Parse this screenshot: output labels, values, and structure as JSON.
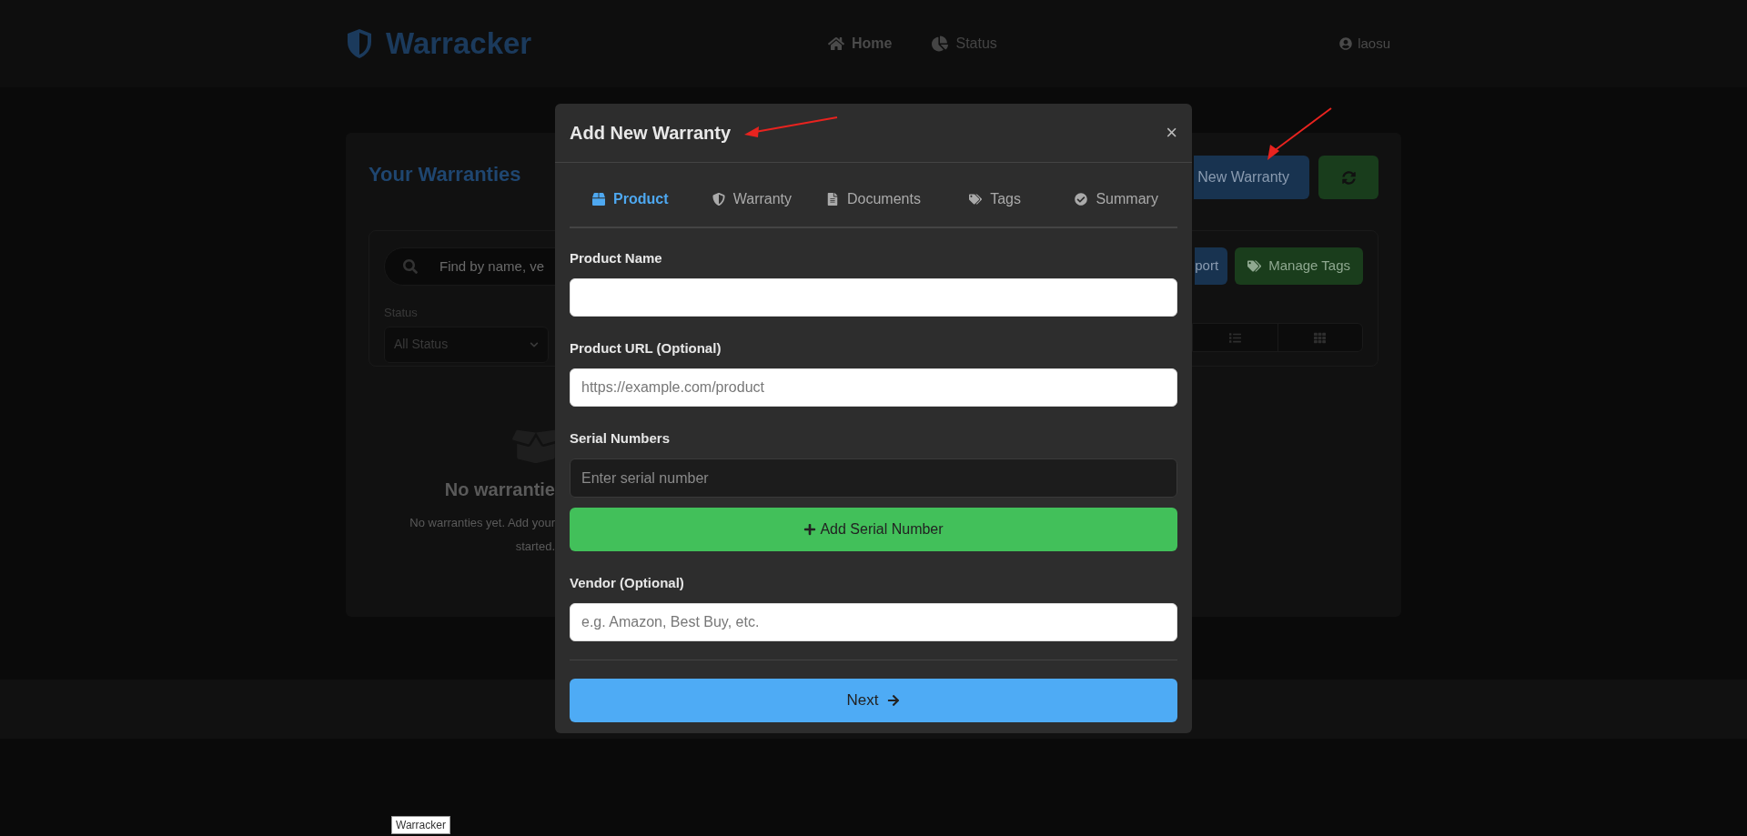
{
  "header": {
    "logo": "Warracker",
    "nav": [
      {
        "label": "Home",
        "kind": "home",
        "selected": true
      },
      {
        "label": "Status",
        "kind": "chart",
        "selected": false
      }
    ],
    "user": "laosu"
  },
  "page": {
    "title": "Your Warranties",
    "new_button": "New Warranty",
    "search": {
      "placeholder": "Find by name, ve"
    },
    "status_filter": {
      "label": "Status",
      "value": "All Status"
    },
    "export_button": "port",
    "manage_tags_button": "Manage Tags",
    "view_toggle": [
      {
        "kind": "list"
      },
      {
        "kind": "grid"
      }
    ],
    "empty_state": {
      "title": "No warrantie",
      "text": "No warranties yet. Add your",
      "text_2": "started."
    }
  },
  "modal": {
    "title": "Add New Warranty",
    "close": "×",
    "tabs": [
      {
        "label": "Product",
        "kind": "box",
        "selected": true
      },
      {
        "label": "Warranty",
        "kind": "shield",
        "selected": false
      },
      {
        "label": "Documents",
        "kind": "file",
        "selected": false
      },
      {
        "label": "Tags",
        "kind": "tags",
        "selected": false
      },
      {
        "label": "Summary",
        "kind": "check",
        "selected": false
      }
    ],
    "fields": [
      {
        "label": "Product Name",
        "kind": "text"
      },
      {
        "label": "Product URL (Optional)",
        "kind": "text",
        "placeholder": "https://example.com/product"
      },
      {
        "label": "Serial Numbers",
        "kind": "serial",
        "placeholder": "Enter serial number",
        "add_button": "Add Serial Number"
      },
      {
        "label": "Vendor (Optional)",
        "kind": "text",
        "placeholder": "e.g. Amazon, Best Buy, etc."
      }
    ],
    "next_button": "Next"
  },
  "tooltip": "Warracker"
}
